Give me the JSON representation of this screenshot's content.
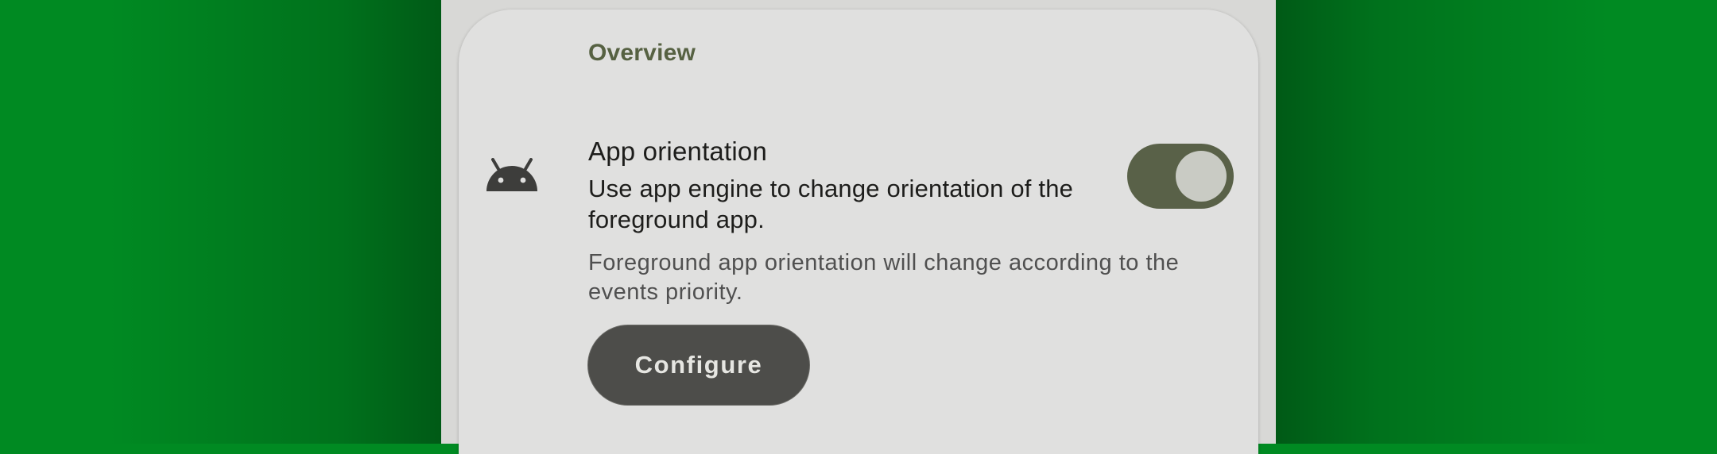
{
  "colors": {
    "background": "#008a22",
    "card": "#e0e0df",
    "accent": "#596148",
    "section_header": "#566142",
    "button": "#4d4d4a"
  },
  "section": {
    "header": "Overview"
  },
  "setting": {
    "icon": "android-icon",
    "title": "App orientation",
    "summary": "Use app engine to change orientation of the foreground app.",
    "description": "Foreground app orientation will change according to the events priority.",
    "switch_checked": true
  },
  "actions": {
    "configure_label": "Configure"
  }
}
